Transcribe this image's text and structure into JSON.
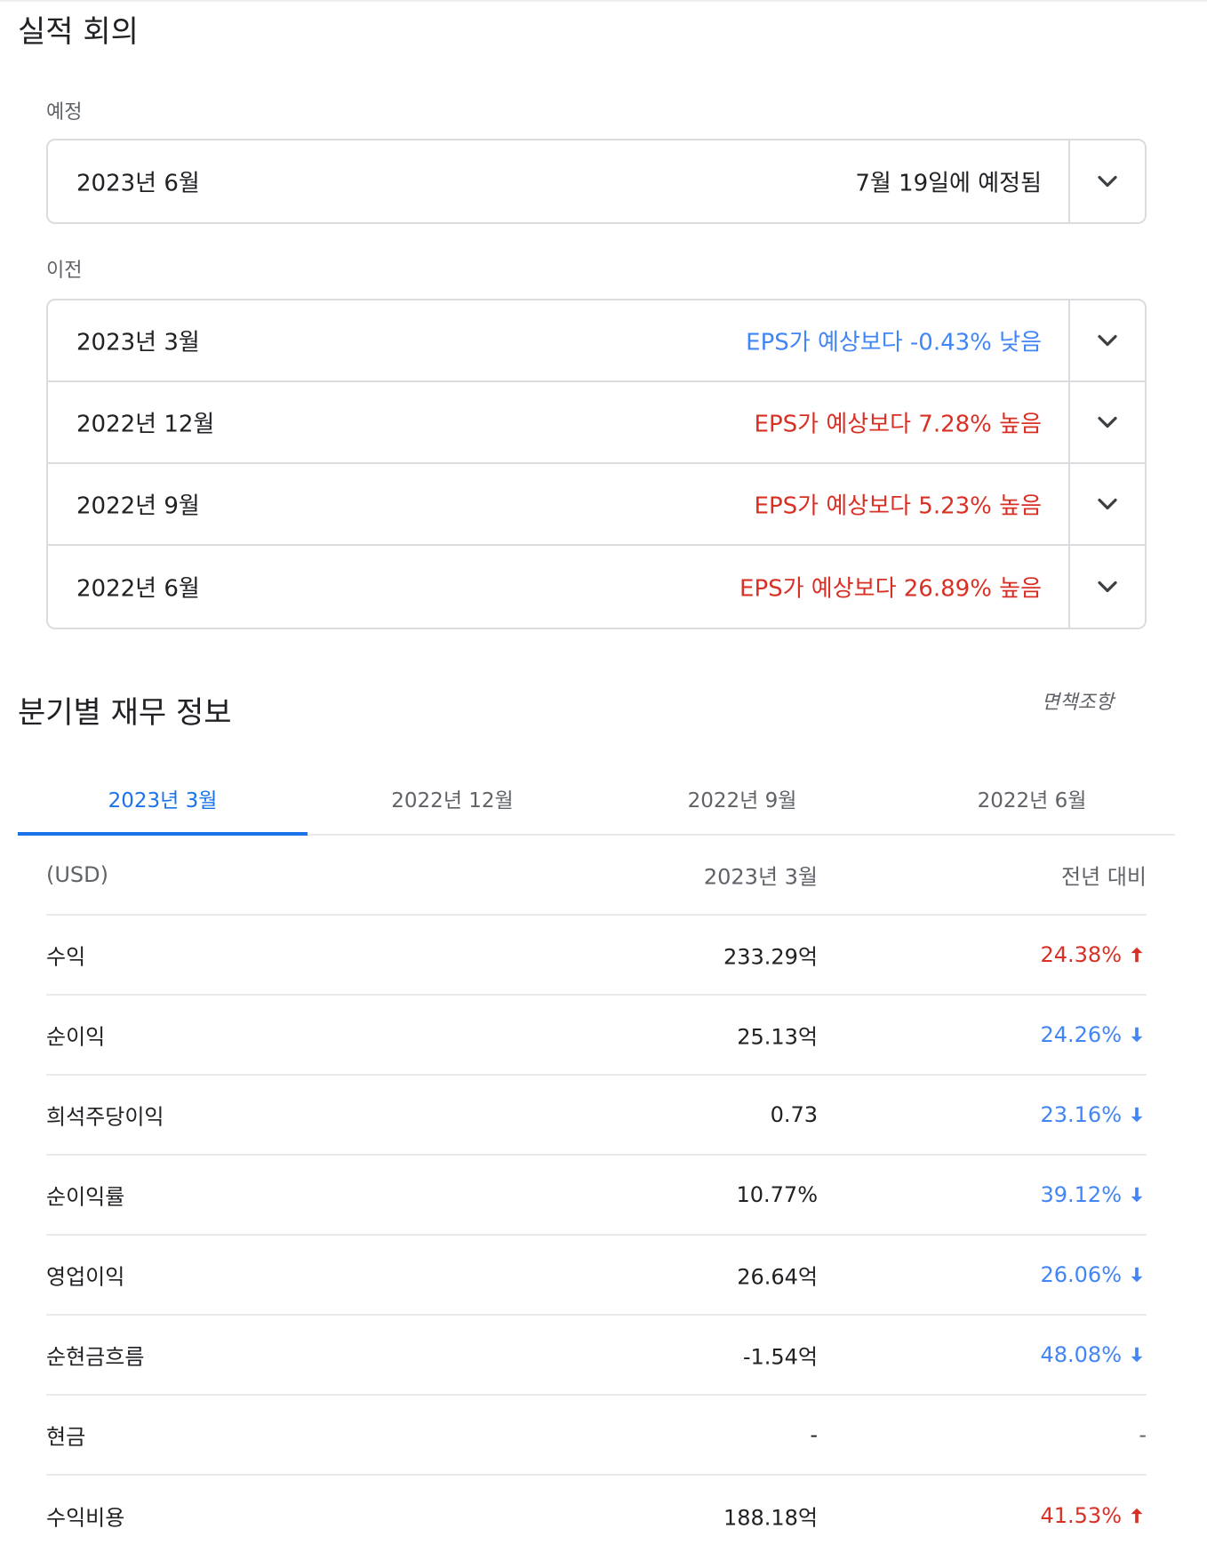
{
  "earnings": {
    "title": "실적 회의",
    "upcoming_label": "예정",
    "upcoming": [
      {
        "period": "2023년 6월",
        "status": "7월 19일에 예정됨",
        "tone": "neutral"
      }
    ],
    "previous_label": "이전",
    "previous": [
      {
        "period": "2023년 3월",
        "status": "EPS가 예상보다 -0.43% 낮음",
        "tone": "low"
      },
      {
        "period": "2022년 12월",
        "status": "EPS가 예상보다 7.28% 높음",
        "tone": "high"
      },
      {
        "period": "2022년 9월",
        "status": "EPS가 예상보다 5.23% 높음",
        "tone": "high"
      },
      {
        "period": "2022년 6월",
        "status": "EPS가 예상보다 26.89% 높음",
        "tone": "high"
      }
    ]
  },
  "financials": {
    "title": "분기별 재무 정보",
    "disclaimer": "면책조항",
    "tabs": [
      "2023년 3월",
      "2022년 12월",
      "2022년 9월",
      "2022년 6월"
    ],
    "active_tab": 0,
    "header": {
      "currency": "(USD)",
      "period": "2023년 3월",
      "yoy": "전년 대비"
    },
    "rows": [
      {
        "label": "수익",
        "value": "233.29억",
        "change": "24.38%",
        "direction": "up"
      },
      {
        "label": "순이익",
        "value": "25.13억",
        "change": "24.26%",
        "direction": "down"
      },
      {
        "label": "희석주당이익",
        "value": "0.73",
        "change": "23.16%",
        "direction": "down"
      },
      {
        "label": "순이익률",
        "value": "10.77%",
        "change": "39.12%",
        "direction": "down"
      },
      {
        "label": "영업이익",
        "value": "26.64억",
        "change": "26.06%",
        "direction": "down"
      },
      {
        "label": "순현금흐름",
        "value": "-1.54억",
        "change": "48.08%",
        "direction": "down"
      },
      {
        "label": "현금",
        "value": "-",
        "change": "-",
        "direction": "none"
      },
      {
        "label": "수익비용",
        "value": "188.18억",
        "change": "41.53%",
        "direction": "up"
      }
    ]
  },
  "colors": {
    "accent": "#1a73e8",
    "positive": "#d93025",
    "negative": "#4285f4",
    "border": "#dadce0"
  },
  "icons": {
    "expand": "chevron-down-icon",
    "up": "arrow-up-icon",
    "down": "arrow-down-icon"
  }
}
